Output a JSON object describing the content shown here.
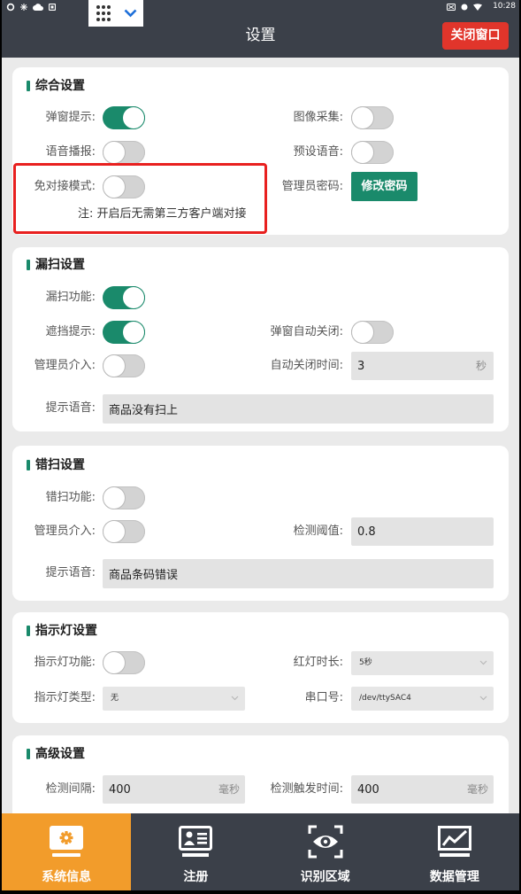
{
  "status_bar": {
    "left_icons": [
      "sync-icon",
      "brightness-icon",
      "cloud-icon",
      "notification-icon"
    ],
    "right_icons": [
      "cast-icon",
      "record-icon",
      "wifi-icon"
    ],
    "time": "10:28"
  },
  "floating_toolbar": {
    "icons": [
      "grid-menu-icon",
      "chevron-down-icon"
    ]
  },
  "header": {
    "title": "设置",
    "close_button": "关闭窗口"
  },
  "general": {
    "title": "综合设置",
    "popup_hint": {
      "label": "弹窗提示:",
      "on": true
    },
    "image_capture": {
      "label": "图像采集:",
      "on": false
    },
    "voice_broadcast": {
      "label": "语音播报:",
      "on": false
    },
    "preset_voice": {
      "label": "预设语音:",
      "on": false
    },
    "no_docking_mode": {
      "label": "免对接模式:",
      "on": false
    },
    "admin_password": {
      "label": "管理员密码:",
      "button": "修改密码"
    },
    "note": "注: 开启后无需第三方客户端对接"
  },
  "missed_scan": {
    "title": "漏扫设置",
    "enabled": {
      "label": "漏扫功能:",
      "on": true
    },
    "occlusion_hint": {
      "label": "遮挡提示:",
      "on": true
    },
    "popup_auto_close": {
      "label": "弹窗自动关闭:",
      "on": false
    },
    "admin_intervene": {
      "label": "管理员介入:",
      "on": false
    },
    "auto_close_time": {
      "label": "自动关闭时间:",
      "value": "3",
      "unit": "秒"
    },
    "prompt_voice": {
      "label": "提示语音:",
      "value": "商品没有扫上"
    }
  },
  "wrong_scan": {
    "title": "错扫设置",
    "enabled": {
      "label": "错扫功能:",
      "on": false
    },
    "admin_intervene": {
      "label": "管理员介入:",
      "on": false
    },
    "threshold": {
      "label": "检测阈值:",
      "value": "0.8"
    },
    "prompt_voice": {
      "label": "提示语音:",
      "value": "商品条码错误"
    }
  },
  "indicator": {
    "title": "指示灯设置",
    "enabled": {
      "label": "指示灯功能:",
      "on": false
    },
    "red_duration": {
      "label": "红灯时长:",
      "selected": "5秒"
    },
    "light_type": {
      "label": "指示灯类型:",
      "selected": "无"
    },
    "serial_port": {
      "label": "串口号:",
      "selected": "/dev/ttySAC4"
    }
  },
  "advanced": {
    "title": "高级设置",
    "detect_interval": {
      "label": "检测间隔:",
      "value": "400",
      "unit": "毫秒"
    },
    "trigger_time": {
      "label": "检测触发时间:",
      "value": "400",
      "unit": "毫秒"
    }
  },
  "bottom_nav": {
    "items": [
      {
        "label": "系统信息",
        "icon": "monitor-gear-icon",
        "active": true
      },
      {
        "label": "注册",
        "icon": "id-card-icon",
        "active": false
      },
      {
        "label": "识别区域",
        "icon": "eye-scan-icon",
        "active": false
      },
      {
        "label": "数据管理",
        "icon": "line-chart-icon",
        "active": false
      }
    ]
  },
  "colors": {
    "header_bg": "#3b4049",
    "content_bg": "#eaeaea",
    "accent_green": "#1a8a6b",
    "close_button_red": "#e1352b",
    "nav_active_orange": "#f29c2b",
    "annotation_red": "#e8201f",
    "toolbar_chevron_blue": "#1e6fd9"
  }
}
